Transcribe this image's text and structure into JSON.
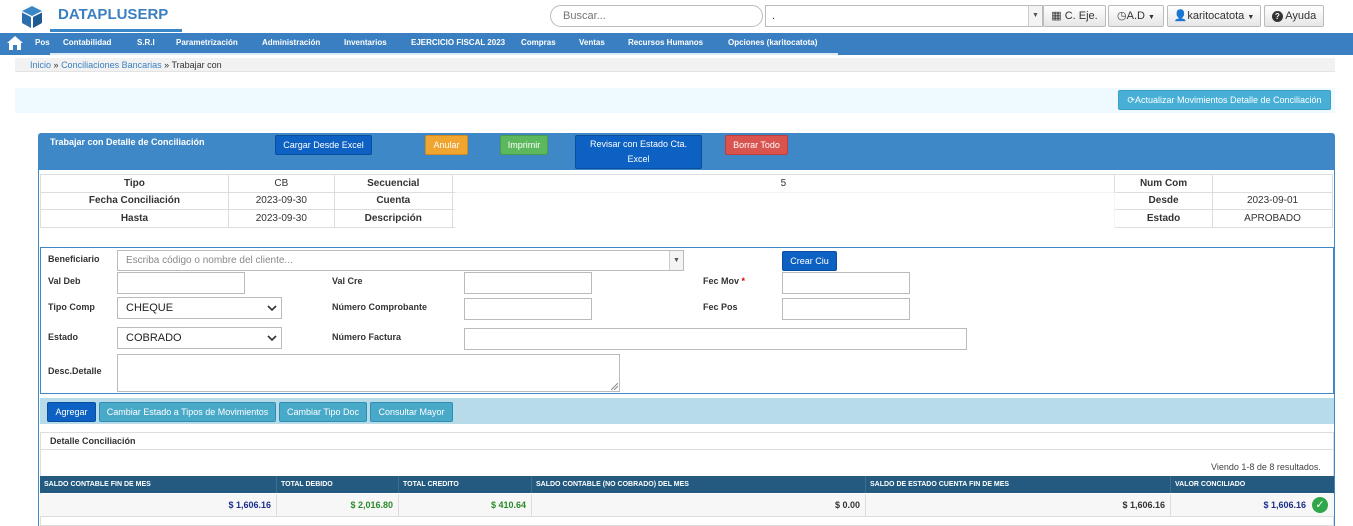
{
  "app": {
    "name": "DATAPLUSERP"
  },
  "top": {
    "search_placeholder": "Buscar...",
    "company_value": ".",
    "ceje": "C. Eje.",
    "ad": "A.D",
    "user": "karitocatota",
    "help": "Ayuda"
  },
  "menu": [
    "Pos",
    "Contabilidad",
    "S.R.I",
    "Parametrización",
    "Administración",
    "Inventarios",
    "EJERCICIO FISCAL 2023",
    "Compras",
    "Ventas",
    "Recursos Humanos",
    "Opciones (karitocatota)"
  ],
  "breadcrumb": {
    "home": "Inicio",
    "sep": "»",
    "section": "Conciliaciones Bancarias",
    "current": "Trabajar con"
  },
  "actualizar_label": "Actualizar Movimientos Detalle de Conciliación",
  "panel": {
    "title": "Trabajar con Detalle de Conciliación",
    "buttons": {
      "cargar": "Cargar Desde Excel",
      "anular": "Anular",
      "imprimir": "Imprimir",
      "revisar_1": "Revisar con Estado Cta.",
      "revisar_2": "Excel",
      "borrar": "Borrar Todo"
    }
  },
  "info": {
    "tipo_label": "Tipo",
    "tipo": "CB",
    "secuencial_label": "Secuencial",
    "secuencial": "5",
    "numcom_label": "Num Com",
    "numcom": "",
    "fecha_label": "Fecha Conciliación",
    "fecha": "2023-09-30",
    "cuenta_label": "Cuenta",
    "desde_label": "Desde",
    "desde": "2023-09-01",
    "hasta_label": "Hasta",
    "hasta": "2023-09-30",
    "descripcion_label": "Descripción",
    "estado_label": "Estado",
    "estado": "APROBADO"
  },
  "form": {
    "beneficiario_label": "Beneficiario",
    "beneficiario_placeholder": "Escriba código o nombre del cliente...",
    "crear_label": "Crear Ciu",
    "valdeb_label": "Val Deb",
    "valcre_label": "Val Cre",
    "fecmov_label": "Fec Mov",
    "required_mark": "*",
    "tipocomp_label": "Tipo Comp",
    "tipocomp_value": "CHEQUE",
    "numcomp_label": "Número Comprobante",
    "fecpos_label": "Fec Pos",
    "estado_label": "Estado",
    "estado_value": "COBRADO",
    "numfact_label": "Número Factura",
    "descdet_label": "Desc.Detalle"
  },
  "actions": {
    "agregar": "Agregar",
    "cambiar_estado": "Cambiar Estado a Tipos de Movimientos",
    "cambiar_tipo": "Cambiar Tipo Doc",
    "consultar": "Consultar Mayor"
  },
  "detalle": {
    "title": "Detalle Conciliación",
    "results": "Viendo 1-8 de 8 resultados.",
    "headers": [
      "SALDO CONTABLE FIN DE MES",
      "TOTAL DEBIDO",
      "TOTAL CREDITO",
      "SALDO CONTABLE (NO COBRADO) DEL MES",
      "SALDO DE ESTADO CUENTA FIN DE MES",
      "VALOR CONCILIADO"
    ],
    "values": [
      "$ 1,606.16",
      "$ 2,016.80",
      "$ 410.64",
      "$ 0.00",
      "$ 1,606.16",
      "$ 1,606.16"
    ]
  },
  "colors": {
    "primary": "#3a7fc1",
    "header": "#245a7f",
    "green": "#2a8a2a",
    "navy": "#1a2f8a"
  }
}
